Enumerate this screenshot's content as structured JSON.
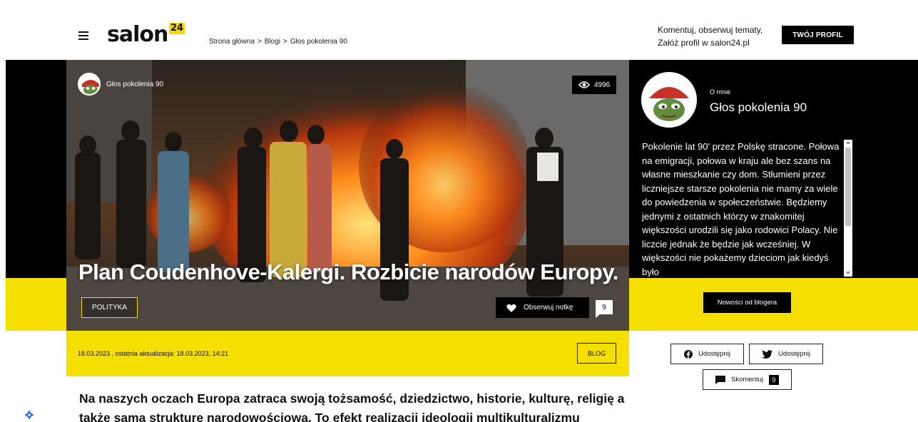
{
  "header": {
    "logo_text": "salon",
    "logo_badge": "24",
    "breadcrumb": [
      "Strona główna",
      ">",
      "Blogi",
      ">",
      "Głos pokolenia 90"
    ],
    "cta_line1": "Komentuj, obserwuj tematy,",
    "cta_line2": "Załóż profil w salon24.pl",
    "profile_button": "TWÓJ PROFIL"
  },
  "hero": {
    "author": "Głos pokolenia 90",
    "views": "4996",
    "title": "Plan Coudenhove-Kalergi. Rozbicie narodów Europy.",
    "category": "POLITYKA",
    "follow_label": "Obserwuj notkę",
    "follow_count": "9"
  },
  "meta": {
    "date": "18.03.2023 , ostatnia aktualizacja: 18.03.2023, 14:21",
    "type_tag": "BLOG"
  },
  "article": {
    "lead": "Na naszych oczach Europa zatraca swoją tożsamość, dziedzictwo, historie, kulturę, religię a także samą strukturę narodowościową. To efekt realizacji ideologii multikulturalizmu"
  },
  "sidebar": {
    "about_label": "O mnie",
    "about_name": "Głos pokolenia 90",
    "about_text": "Pokolenie lat 90' przez Polskę stracone. Połowa na emigracji, połowa w kraju ale bez szans na własne mieszkanie czy dom. Stłumieni przez liczniejsze starsze pokolenia nie mamy za wiele do powiedzenia w społeczeństwie. Będziemy jednymi z ostatnich którzy w znakomitej większości urodzili się jako rodowici Polacy. Nie liczcie jednak że będzie jak wcześniej. W większości nie pokażemy dzieciom jak kiedyś było",
    "news_button": "Nowości od blogera",
    "share_facebook": "Udostępnij",
    "share_twitter": "Udostępnij",
    "comment_label": "Skomentuj",
    "comment_count": "9"
  },
  "colors": {
    "brand_yellow": "#f5df00",
    "black": "#000000"
  }
}
